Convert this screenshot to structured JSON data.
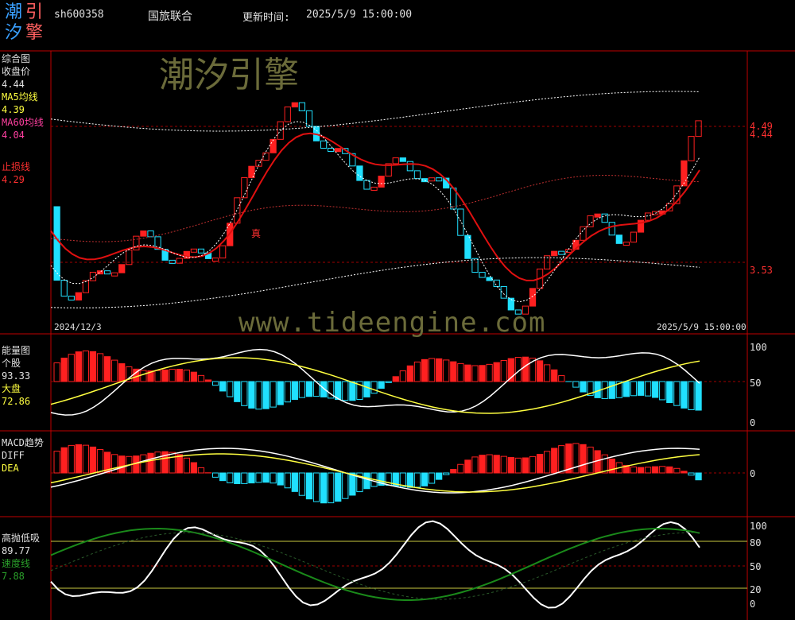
{
  "header": {
    "logo_chars": [
      "潮",
      "引",
      "汐",
      "擎"
    ],
    "code": "sh600358",
    "name": "国旅联合",
    "update_label": "更新时间:",
    "update_time": "2025/5/9 15:00:00"
  },
  "watermark": {
    "cn": "潮汐引擎",
    "url": "www.tideengine.com"
  },
  "colors": {
    "up": "#ff2020",
    "down": "#20e0ff",
    "axis": "#c00000",
    "ma5": "#ffffff",
    "ma60": "#e01010",
    "yellow": "#ffff40",
    "green": "#1a8a1a"
  },
  "panel_main": {
    "title": "综合图",
    "close_label": "收盘价",
    "close_value": "4.44",
    "ma5_label": "MA5均线",
    "ma5_value": "4.39",
    "ma60_label": "MA60均线",
    "ma60_value": "4.04",
    "stop_label": "止损线",
    "stop_value": "4.29",
    "right_ticks": [
      "4.49",
      "4.44",
      "3.53"
    ],
    "date_start": "2024/12/3",
    "date_end": "2025/5/9 15:00:00",
    "mark_char": "真"
  },
  "panel_energy": {
    "title": "能量图",
    "stock_label": "个股",
    "stock_value": "93.33",
    "market_label": "大盘",
    "market_value": "72.86",
    "right_ticks": [
      "100",
      "50",
      "0"
    ]
  },
  "panel_macd": {
    "title": "MACD趋势",
    "diff_label": "DIFF",
    "dea_label": "DEA",
    "right_ticks": [
      "0"
    ]
  },
  "panel_hl": {
    "title": "高抛低吸",
    "value": "89.77",
    "speed_label": "速度线",
    "speed_value": "7.88",
    "right_ticks": [
      "100",
      "80",
      "50",
      "20",
      "0"
    ]
  }
}
